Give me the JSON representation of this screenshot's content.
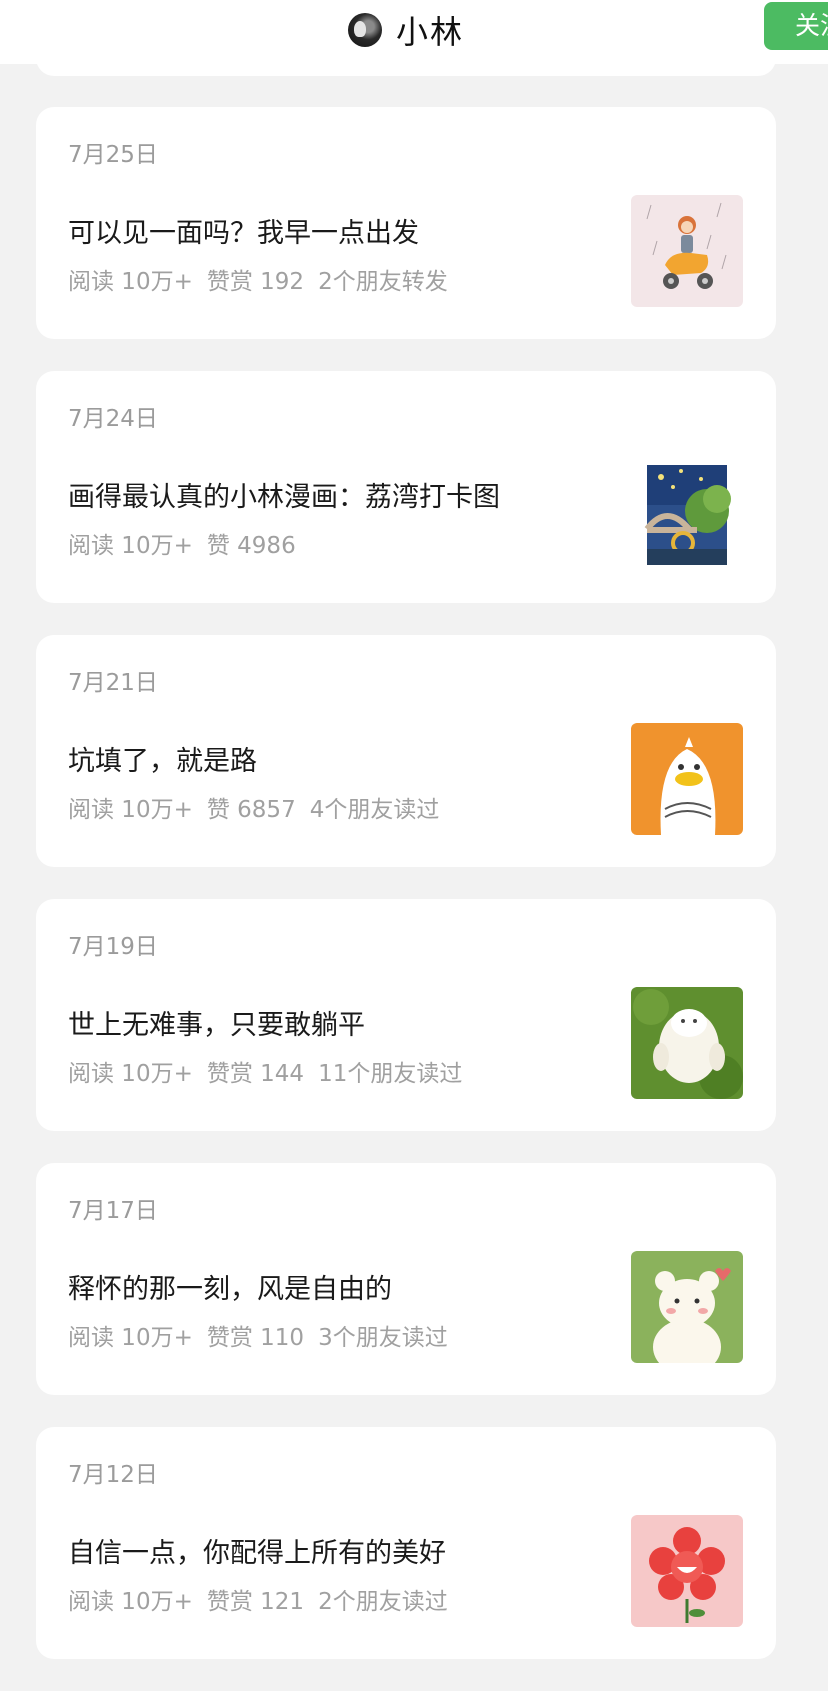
{
  "header": {
    "title": "小林",
    "follow_label": "关注"
  },
  "articles": [
    {
      "date": "7月25日",
      "title": "可以见一面吗？我早一点出发",
      "reads": "阅读 10万+",
      "likes": "赞赏 192",
      "friends": "2个朋友转发",
      "thumb": "scooter-rain-illustration"
    },
    {
      "date": "7月24日",
      "title": "画得最认真的小林漫画：荔湾打卡图",
      "reads": "阅读 10万+",
      "likes": "赞 4986",
      "friends": "",
      "thumb": "night-bridge-illustration"
    },
    {
      "date": "7月21日",
      "title": "坑填了，就是路",
      "reads": "阅读 10万+",
      "likes": "赞 6857",
      "friends": "4个朋友读过",
      "thumb": "duck-illustration"
    },
    {
      "date": "7月19日",
      "title": "世上无难事，只要敢躺平",
      "reads": "阅读 10万+",
      "likes": "赞赏 144",
      "friends": "11个朋友读过",
      "thumb": "lying-animal-illustration"
    },
    {
      "date": "7月17日",
      "title": "释怀的那一刻，风是自由的",
      "reads": "阅读 10万+",
      "likes": "赞赏 110",
      "friends": "3个朋友读过",
      "thumb": "bear-illustration"
    },
    {
      "date": "7月12日",
      "title": "自信一点，你配得上所有的美好",
      "reads": "阅读 10万+",
      "likes": "赞赏 121",
      "friends": "2个朋友读过",
      "thumb": "smiling-flower-illustration"
    }
  ]
}
